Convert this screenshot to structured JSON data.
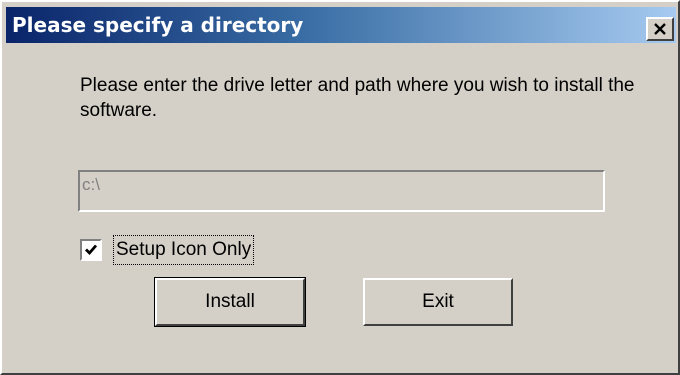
{
  "window": {
    "title": "Please specify a directory",
    "close_icon": "close-icon"
  },
  "prompt": {
    "text": "Please enter the drive letter and path where you wish to install the software."
  },
  "path_input": {
    "value": "c:\\",
    "enabled": false
  },
  "setup_icon_only": {
    "label": "Setup Icon Only",
    "checked": true
  },
  "buttons": {
    "install_label": "Install",
    "exit_label": "Exit"
  },
  "colors": {
    "title_gradient_start": "#0a246a",
    "title_gradient_end": "#a6caf0",
    "dialog_face": "#d4d0c8",
    "disabled_text": "#808080"
  }
}
